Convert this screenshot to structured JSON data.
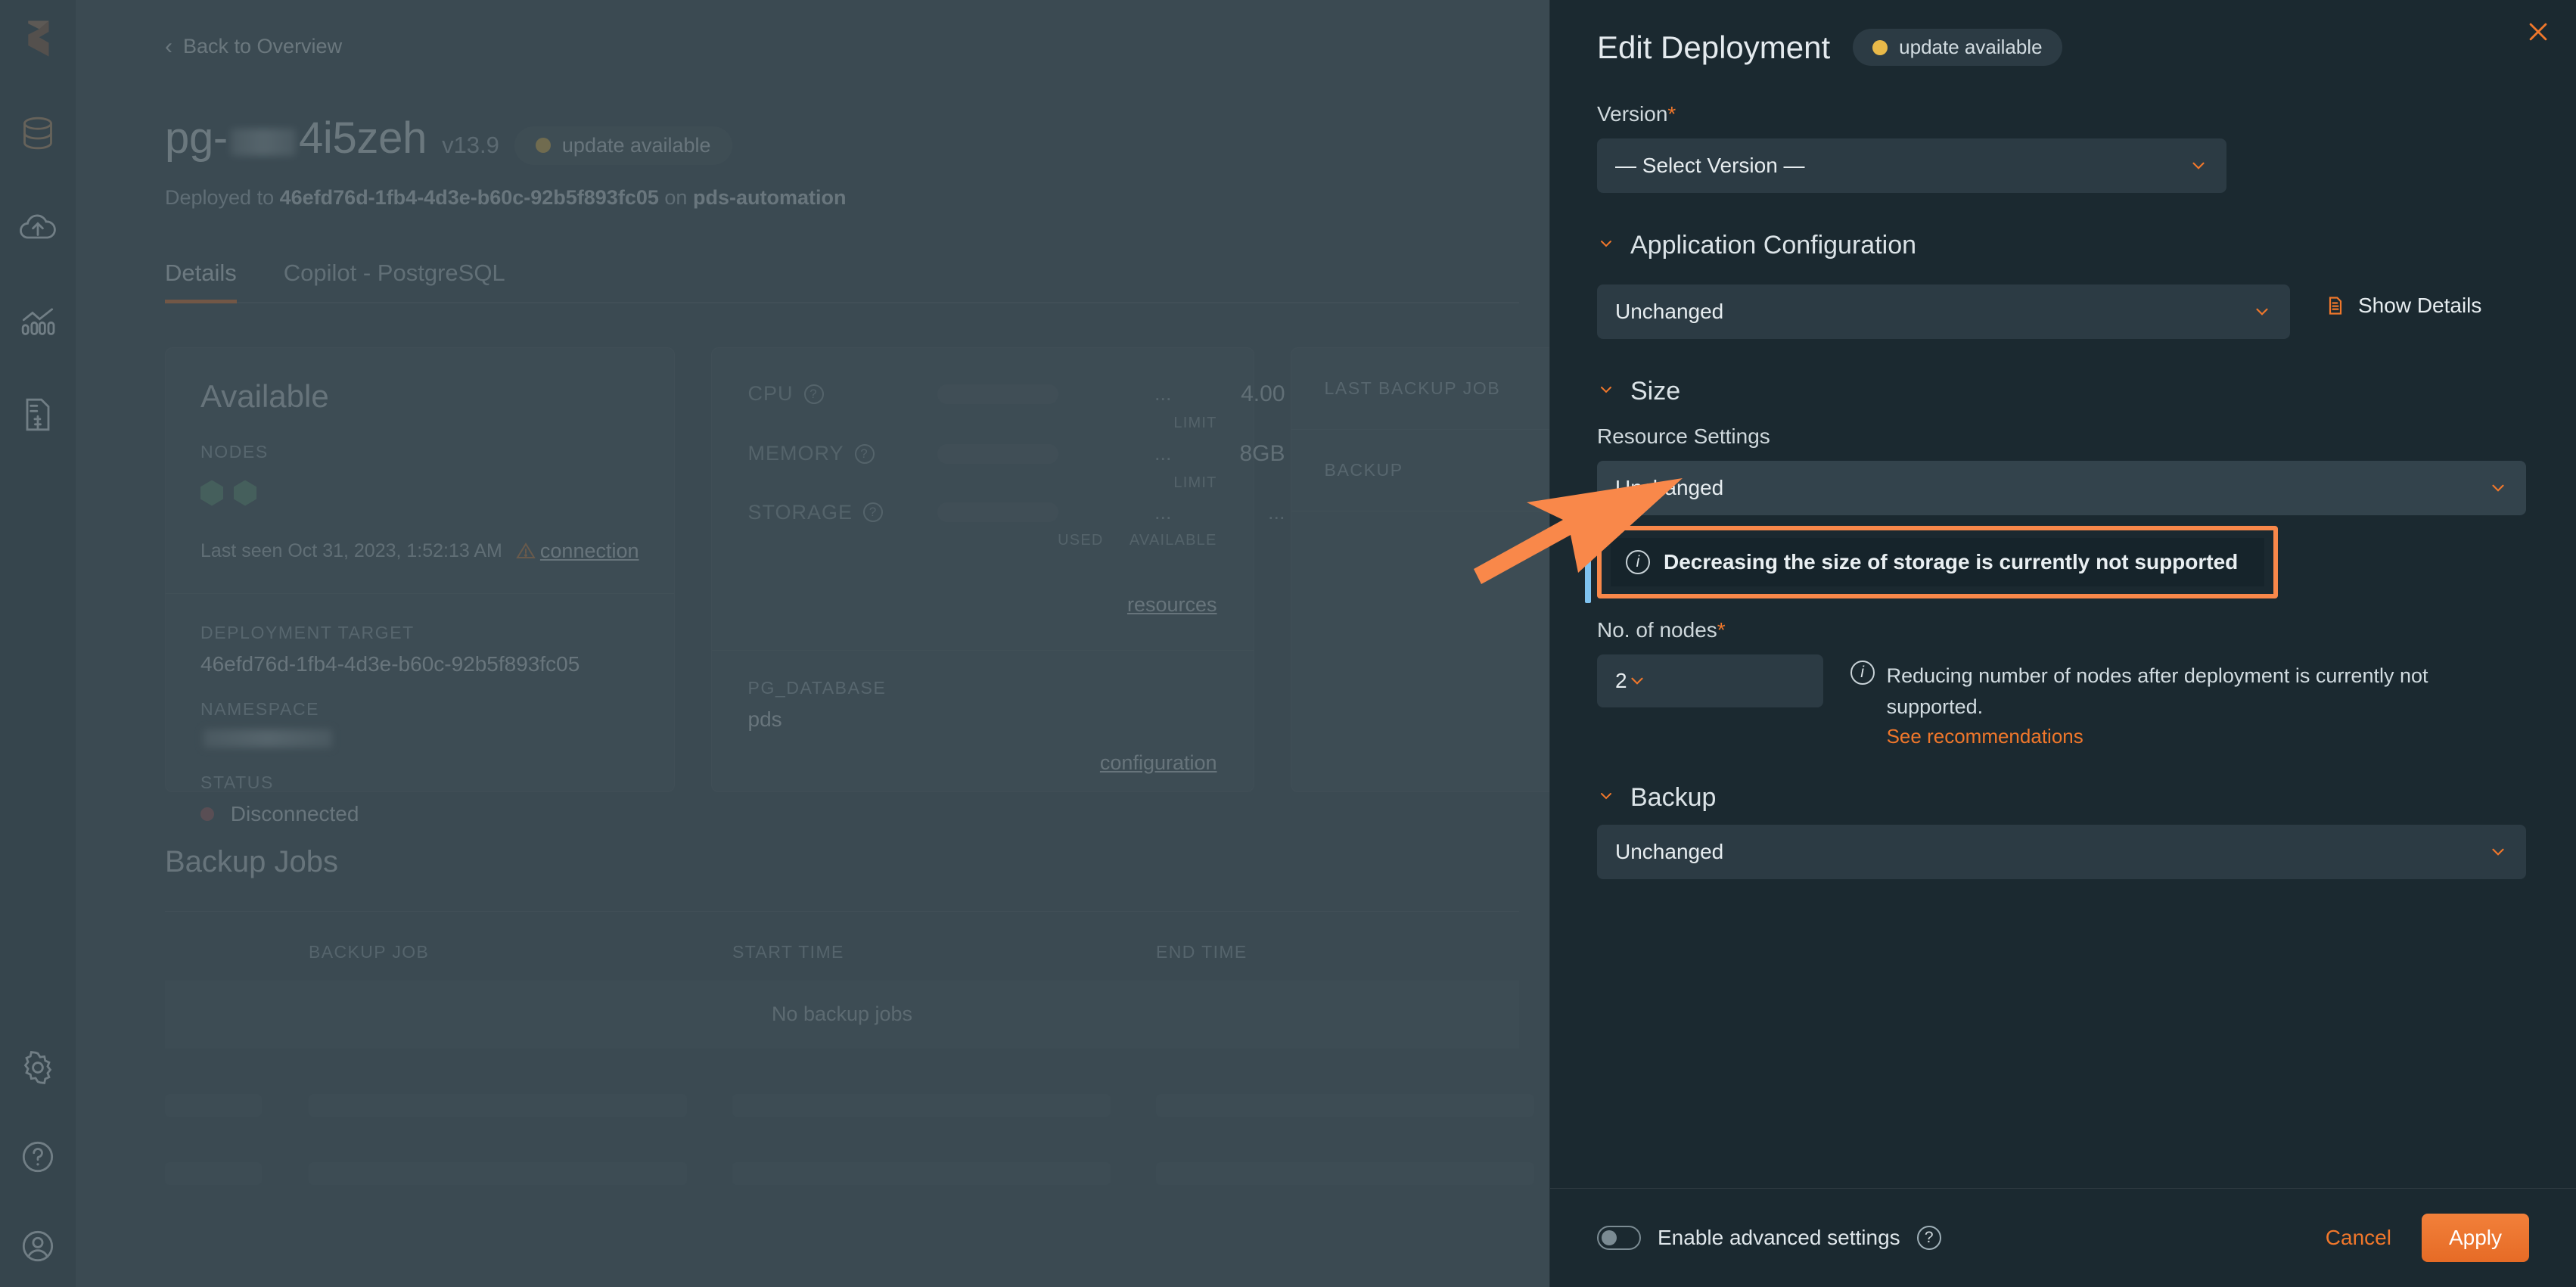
{
  "rail": {
    "logo": "portworx-logo",
    "items": [
      {
        "icon": "database-icon",
        "name": "databases"
      },
      {
        "icon": "cloud-upload-icon",
        "name": "deployments"
      },
      {
        "icon": "monitoring-chart-icon",
        "name": "monitoring"
      },
      {
        "icon": "billing-document-icon",
        "name": "billing"
      }
    ],
    "bottom": [
      {
        "icon": "gear-icon",
        "name": "settings"
      },
      {
        "icon": "help-circle-icon",
        "name": "help"
      },
      {
        "icon": "user-circle-icon",
        "name": "account"
      }
    ]
  },
  "page": {
    "back_link": "Back to Overview",
    "title_prefix": "pg-",
    "title_suffix": "4i5zeh",
    "version": "v13.9",
    "update_badge": "update available",
    "deployed_prefix": "Deployed to",
    "deployed_target": "46efd76d-1fb4-4d3e-b60c-92b5f893fc05",
    "deployed_on": "on",
    "deployed_namespace": "pds-automation",
    "tabs": [
      {
        "label": "Details",
        "active": true
      },
      {
        "label": "Copilot - PostgreSQL",
        "active": false
      }
    ],
    "status_card": {
      "heading": "Available",
      "nodes_label": "NODES",
      "node_count": 2,
      "last_seen": "Last seen Oct 31, 2023, 1:52:13 AM",
      "connection_link": "connection",
      "deployment_target_label": "DEPLOYMENT TARGET",
      "deployment_target_value": "46efd76d-1fb4-4d3e-b60c-92b5f893fc05",
      "namespace_label": "NAMESPACE",
      "namespace_value": "",
      "status_label": "STATUS",
      "status_value": "Disconnected"
    },
    "resource_card": {
      "metrics": [
        {
          "name": "CPU",
          "used": "...",
          "value": "4.00",
          "sub": "LIMIT"
        },
        {
          "name": "MEMORY",
          "used": "...",
          "value": "8GB",
          "sub": "LIMIT"
        },
        {
          "name": "STORAGE",
          "used": "...",
          "value": "...",
          "sub_used": "USED",
          "sub_avail": "AVAILABLE"
        }
      ],
      "resources_link": "resources",
      "db_label": "PG_DATABASE",
      "db_value": "pds",
      "configuration_link": "configuration"
    },
    "backup_card": {
      "last_backup_job_label": "LAST BACKUP JOB",
      "backup_label": "BACKUP"
    },
    "backup_jobs": {
      "heading": "Backup Jobs",
      "columns": [
        "",
        "BACKUP JOB",
        "START TIME",
        "END TIME"
      ],
      "empty_text": "No backup jobs"
    }
  },
  "panel": {
    "title": "Edit Deployment",
    "badge": "update available",
    "close_icon": "close-icon",
    "version": {
      "label": "Version",
      "required": "*",
      "selected": "— Select Version —"
    },
    "application_configuration": {
      "section_title": "Application Configuration",
      "selected": "Unchanged",
      "show_details": "Show Details"
    },
    "size": {
      "section_title": "Size",
      "resource_settings_label": "Resource Settings",
      "resource_settings_selected": "Unchanged",
      "alert_text": "Decreasing the size of storage is currently not supported",
      "nodes_label": "No. of nodes",
      "nodes_required": "*",
      "nodes_value": "2",
      "nodes_note": "Reducing number of nodes after deployment is currently not supported.",
      "nodes_link": "See recommendations"
    },
    "backup": {
      "section_title": "Backup",
      "selected": "Unchanged"
    },
    "footer": {
      "toggle_label": "Enable advanced settings",
      "toggle_on": false,
      "help_icon": "help-circle-icon",
      "cancel_label": "Cancel",
      "apply_label": "Apply"
    }
  },
  "colors": {
    "accent_orange": "#f0772b",
    "highlight_orange": "#f9884a",
    "panel_bg": "#1b2930",
    "page_bg": "#3b4a52",
    "amber_dot": "#e9b949",
    "blue_bar": "#7fc2ef"
  }
}
